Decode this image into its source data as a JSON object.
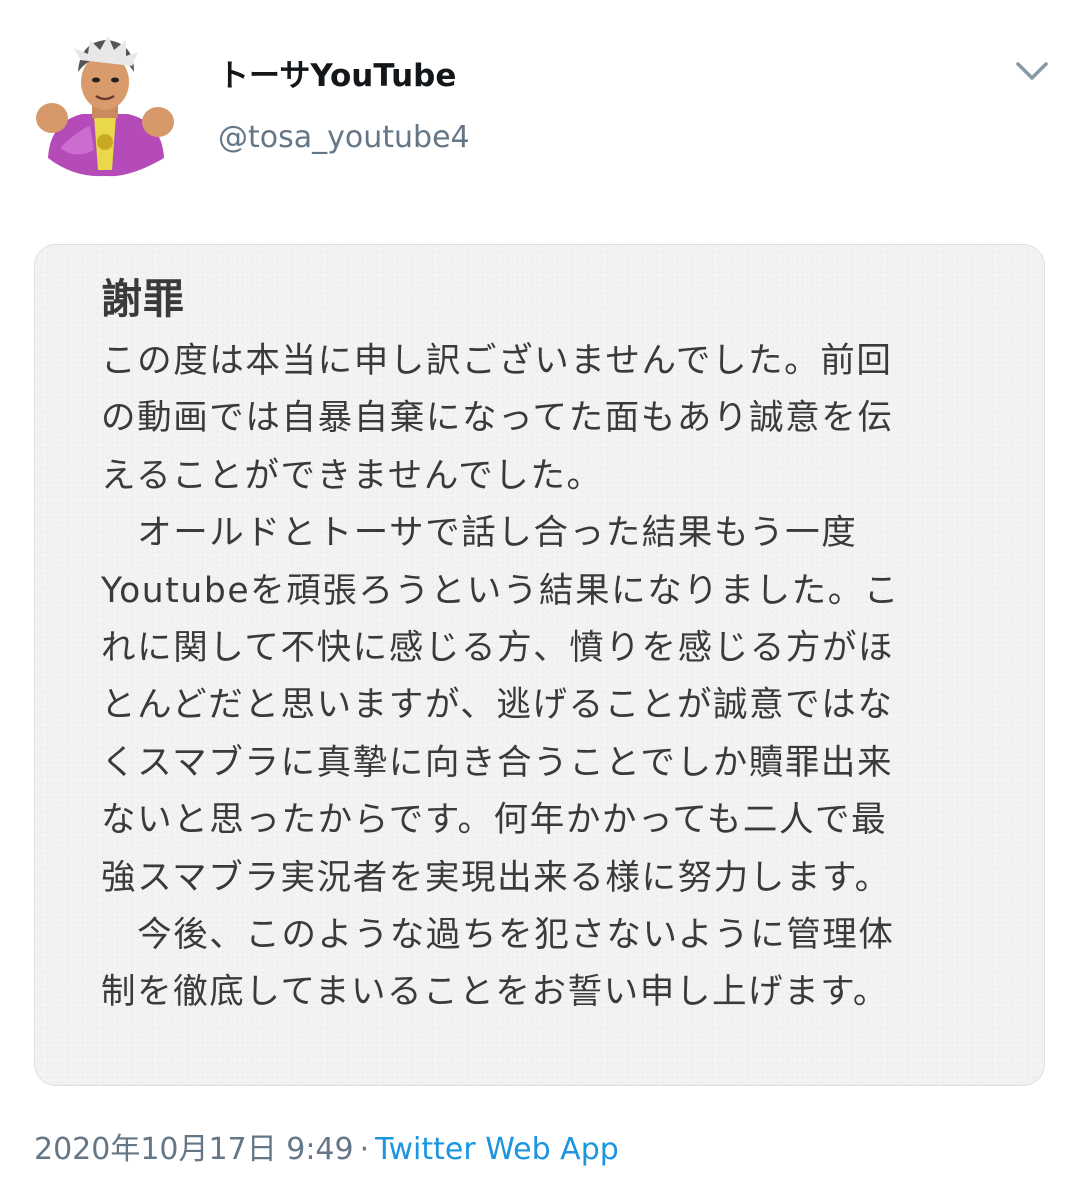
{
  "account": {
    "display_name": "トーサYouTube",
    "handle": "@tosa_youtube4"
  },
  "header": {
    "menu_icon": "chevron-down-icon"
  },
  "media": {
    "title": "謝罪",
    "lines": [
      "この度は本当に申し訳ございませんでした。前回",
      "の動画では自暴自棄になってた面もあり誠意を伝",
      "えることができませんでした。",
      "　オールドとトーサで話し合った結果もう一度",
      "Youtubeを頑張ろうという結果になりました。こ",
      "れに関して不快に感じる方、憤りを感じる方がほ",
      "とんどだと思いますが、逃げることが誠意ではな",
      "くスマブラに真摯に向き合うことでしか贖罪出来",
      "ないと思ったからです。何年かかっても二人で最",
      "強スマブラ実況者を実現出来る様に努力します。",
      "　今後、このような過ちを犯さないように管理体",
      "制を徹底してまいることをお誓い申し上げます。"
    ]
  },
  "footer": {
    "timestamp": "2020年10月17日 9:49",
    "separator": "·",
    "source": "Twitter Web App"
  },
  "colors": {
    "name": "#14171a",
    "secondary": "#657786",
    "link": "#1b95e0",
    "paper": "#f3f3f1",
    "ink": "#3a3a3a"
  }
}
